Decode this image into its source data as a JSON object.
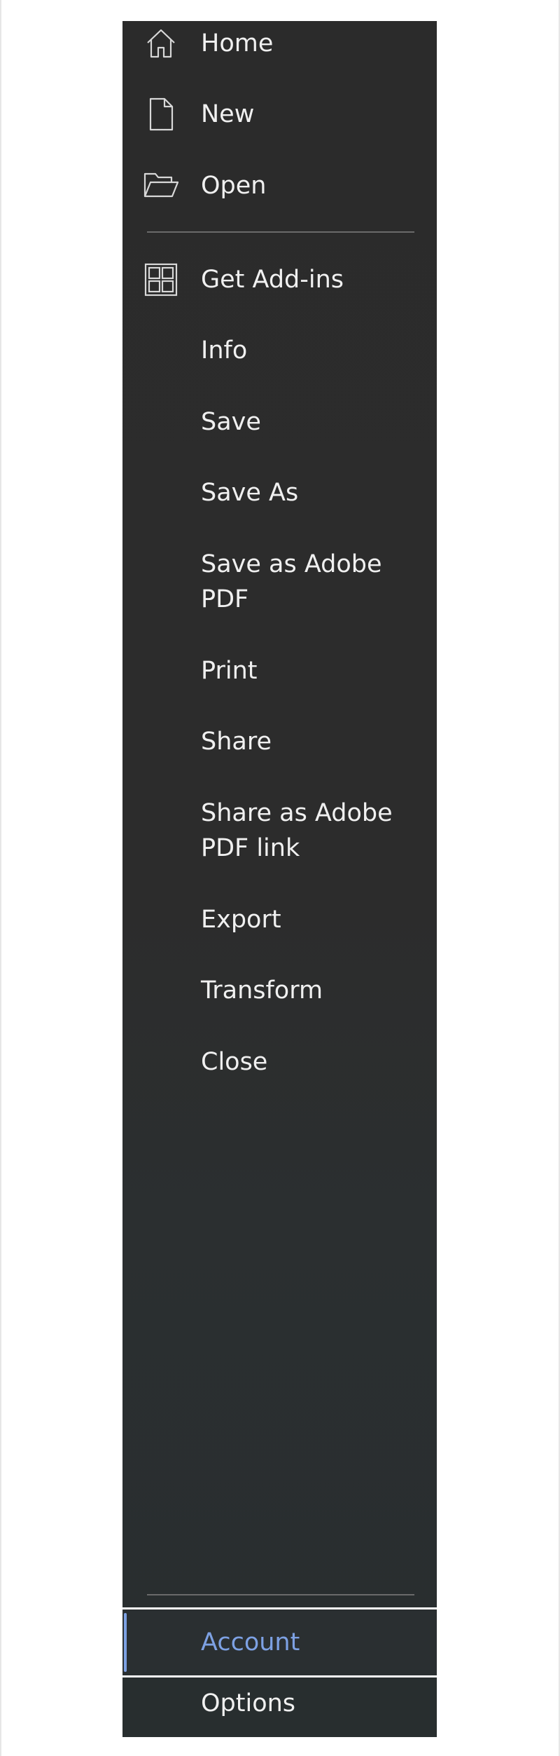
{
  "menu": {
    "home": {
      "label": "Home",
      "icon": "home-icon"
    },
    "new": {
      "label": "New",
      "icon": "new-document-icon"
    },
    "open": {
      "label": "Open",
      "icon": "folder-open-icon"
    },
    "get_addins": {
      "label": "Get Add-ins",
      "icon": "add-ins-grid-icon"
    },
    "info": {
      "label": "Info"
    },
    "save": {
      "label": "Save"
    },
    "save_as": {
      "label": "Save As"
    },
    "save_as_pdf": {
      "line1": "Save as Adobe",
      "line2": "PDF"
    },
    "print": {
      "label": "Print"
    },
    "share": {
      "label": "Share"
    },
    "share_pdf_link": {
      "line1": "Share as Adobe",
      "line2": "PDF link"
    },
    "export": {
      "label": "Export"
    },
    "transform": {
      "label": "Transform"
    },
    "close": {
      "label": "Close"
    },
    "account": {
      "label": "Account",
      "selected": true
    },
    "options": {
      "label": "Options"
    }
  },
  "colors": {
    "panel_background": "#2b2b2b",
    "text": "#f0f0f0",
    "selected_accent": "#7da1e3",
    "divider": "#6a6a6a"
  }
}
